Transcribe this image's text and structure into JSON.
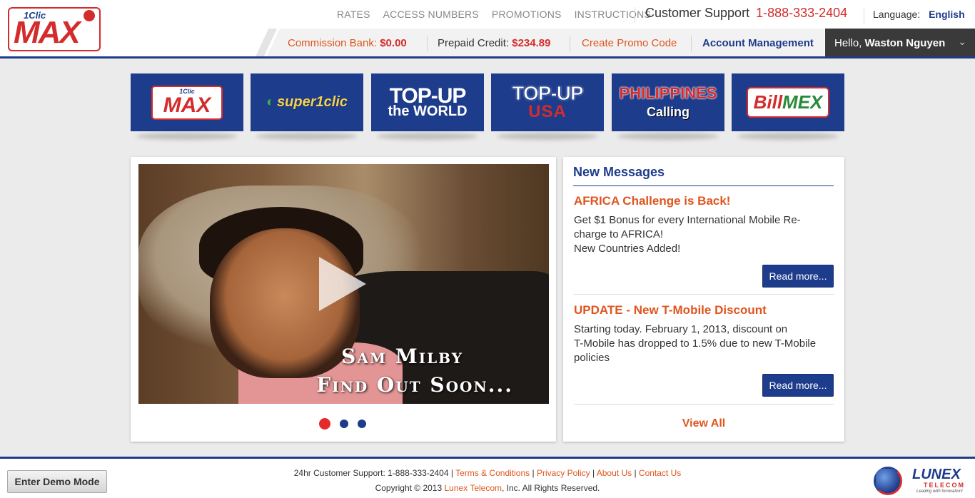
{
  "header": {
    "logo": {
      "top_text": "1Clic",
      "main_text": "MAX"
    },
    "nav": [
      "RATES",
      "ACCESS NUMBERS",
      "PROMOTIONS",
      "INSTRUCTIONS"
    ],
    "support_label": "Customer Support",
    "support_phone": "1-888-333-2404",
    "language_label": "Language:",
    "language_value": "English",
    "commission_label": "Commission Bank:",
    "commission_value": "$0.00",
    "credit_label": "Prepaid Credit:",
    "credit_value": "$234.89",
    "promo_link": "Create Promo Code",
    "account_link": "Account Management",
    "hello_prefix": "Hello,",
    "user_name": "Waston Nguyen"
  },
  "brands": [
    {
      "name": "1Clic MAX",
      "top": "1Clic",
      "main": "MAX"
    },
    {
      "name": "super1clic",
      "main": "super1clic"
    },
    {
      "name": "TOP-UP the WORLD",
      "main": "TOP-UP",
      "sub": "the WORLD"
    },
    {
      "name": "TOP-UP USA",
      "main": "TOP-UP",
      "sub": "USA"
    },
    {
      "name": "PHILIPPINES Calling",
      "main": "PHILIPPINES",
      "sub": "Calling"
    },
    {
      "name": "BillMEX",
      "main": "Bill",
      "sub": "MEX"
    }
  ],
  "video": {
    "caption_line1": "Sam Milby",
    "caption_line2": "Find Out Soon..."
  },
  "slider": {
    "count": 3,
    "active": 1
  },
  "messages": {
    "title": "New Messages",
    "items": [
      {
        "headline": "AFRICA Challenge is Back!",
        "lines": [
          "Get $1 Bonus for every International Mobile Re-",
          "charge to AFRICA!",
          "New Countries Added!"
        ],
        "button": "Read more..."
      },
      {
        "headline": "UPDATE - New T-Mobile Discount",
        "lines": [
          "Starting today. February 1, 2013, discount on",
          "T-Mobile has dropped to 1.5% due to new T-Mobile",
          "policies"
        ],
        "button": "Read more..."
      }
    ],
    "view_all": "View All"
  },
  "footer": {
    "demo_button": "Enter Demo Mode",
    "support_text": "24hr Customer Support: 1-888-333-2404",
    "links": [
      "Terms & Conditions",
      "Privacy Policy",
      "About Us",
      "Contact Us"
    ],
    "copyright_prefix": "Copyright © 2013",
    "company_link": "Lunex Telecom",
    "copyright_suffix": ", Inc. All Rights Reserved.",
    "lunex_logo": {
      "name": "LUNEX",
      "sub": "TELECOM",
      "tagline": "Leading with Innovation!"
    }
  },
  "colors": {
    "brand_blue": "#1e3c8c",
    "brand_red": "#d42c2c",
    "accent_orange": "#e0551e"
  }
}
